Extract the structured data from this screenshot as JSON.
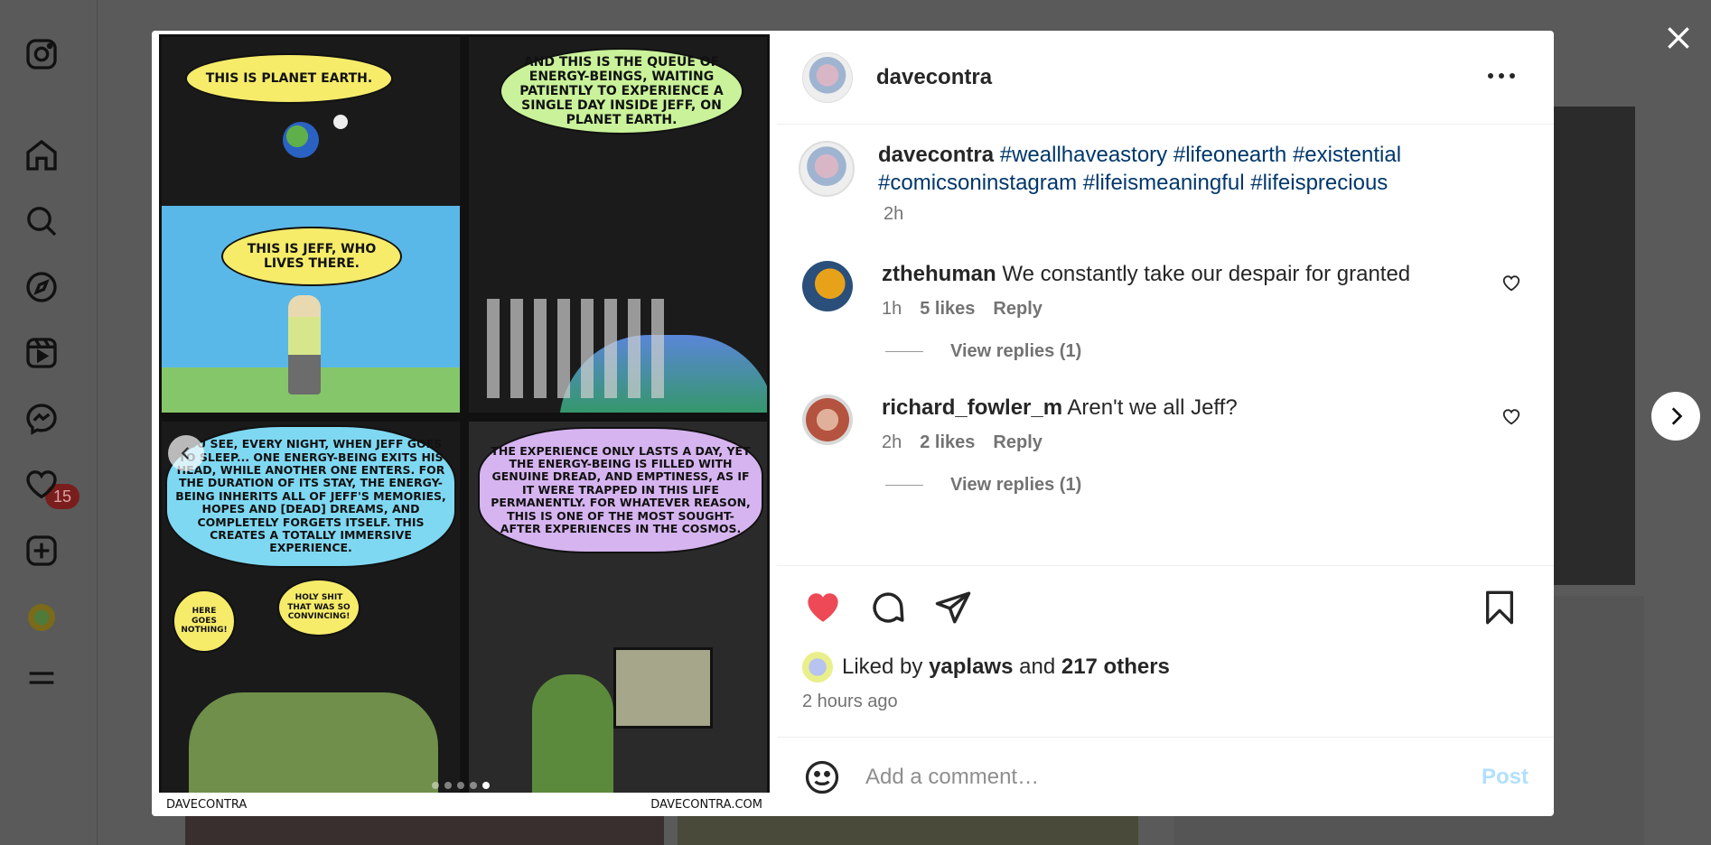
{
  "sidebar": {
    "icons": [
      "instagram-logo-icon",
      "home-icon",
      "search-icon",
      "explore-icon",
      "reels-icon",
      "messenger-icon",
      "heart-icon",
      "create-icon",
      "profile-icon",
      "menu-icon"
    ],
    "messenger_badge": "15"
  },
  "post": {
    "author": "davecontra",
    "caption": {
      "username": "davecontra",
      "hashtags": [
        "#weallhaveastory",
        "#lifeonearth",
        "#existential",
        "#comicsoninstagram",
        "#lifeismeaningful",
        "#lifeisprecious"
      ],
      "time": "2h"
    },
    "comic": {
      "panel1_top": "THIS IS PLANET EARTH.",
      "panel1_bottom": "THIS IS JEFF, WHO LIVES THERE.",
      "panel2": "AND THIS IS THE QUEUE OF ENERGY-BEINGS, WAITING PATIENTLY TO EXPERIENCE A SINGLE DAY INSIDE JEFF, ON PLANET EARTH.",
      "panel3": "YOU SEE, EVERY NIGHT, WHEN JEFF GOES TO SLEEP... ONE ENERGY-BEING EXITS HIS HEAD, WHILE ANOTHER ONE ENTERS. FOR THE DURATION OF ITS STAY, THE ENERGY-BEING INHERITS ALL OF JEFF'S MEMORIES, HOPES AND [DEAD] DREAMS, AND COMPLETELY FORGETS ITSELF. THIS CREATES A TOTALLY IMMERSIVE EXPERIENCE.",
      "panel3_left": "HERE GOES NOTHING!",
      "panel3_right": "HOLY SHIT THAT WAS SO CONVINCING!",
      "panel4": "THE EXPERIENCE ONLY LASTS A DAY, YET THE ENERGY-BEING IS FILLED WITH GENUINE DREAD, AND EMPTINESS, AS IF IT WERE TRAPPED IN THIS LIFE PERMANENTLY. FOR WHATEVER REASON, THIS IS ONE OF THE MOST SOUGHT-AFTER EXPERIENCES IN THE COSMOS.",
      "footer_left": "DAVECONTRA",
      "footer_right": "DAVECONTRA.COM"
    },
    "comments": [
      {
        "username": "zthehuman",
        "text": "We constantly take our despair for granted",
        "time": "1h",
        "likes": "5 likes",
        "reply": "Reply",
        "view_replies": "View replies (1)",
        "avatar_color": "#e8a21a"
      },
      {
        "username": "richard_fowler_m",
        "text": "Aren't we all Jeff?",
        "time": "2h",
        "likes": "2 likes",
        "reply": "Reply",
        "view_replies": "View replies (1)",
        "avatar_color": "#b4533f"
      }
    ],
    "liked_by": {
      "prefix": "Liked by",
      "user": "yaplaws",
      "and": "and",
      "others": "217 others"
    },
    "posted_ago": "2 hours ago",
    "add_comment_placeholder": "Add a comment…",
    "post_label": "Post"
  },
  "colors": {
    "heart": "#ed4956",
    "hashtag": "#00376b",
    "muted": "#737373",
    "post_disabled": "#b2dffc"
  }
}
